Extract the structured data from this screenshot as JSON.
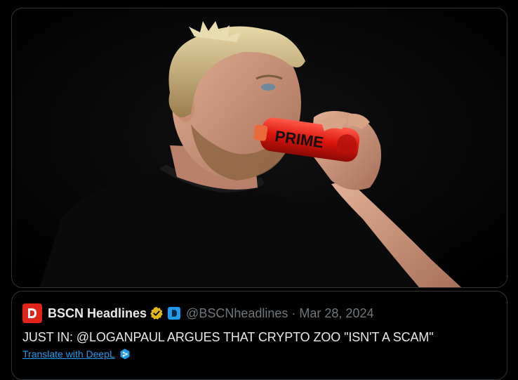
{
  "media": {
    "bottle_text": "PRIME"
  },
  "quote": {
    "author_name": "BSCN Headlines",
    "handle": "@BSCNheadlines",
    "separator": "·",
    "date": "Mar 28, 2024",
    "text": "JUST IN: @LOGANPAUL ARGUES THAT CRYPTO ZOO \"ISN'T A SCAM\"",
    "translate_label": "Translate with DeepL"
  },
  "colors": {
    "avatar_red": "#e0241a",
    "verified_gold": "#e2b719",
    "link_blue": "#1d9bf0",
    "text_primary": "#e7e9ea",
    "text_secondary": "#71767b"
  }
}
